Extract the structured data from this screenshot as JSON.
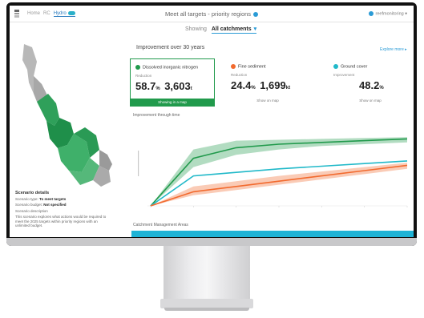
{
  "header": {
    "tabs": [
      {
        "label": "Home"
      },
      {
        "label": "RC"
      },
      {
        "label": "Hydro"
      }
    ],
    "title": "Meet all targets - priority regions",
    "user": "reefmonitoring"
  },
  "showing": {
    "label": "Showing",
    "value": "All catchments"
  },
  "panel": {
    "title": "Improvement over 30 years",
    "explore_link": "Explore more ▸"
  },
  "cards": [
    {
      "label": "Dissolved inorganic nitrogen",
      "color": "#219a4c",
      "sub": "Reduction",
      "percent": "58.7",
      "percent_unit": "%",
      "amount": "3,603",
      "amount_unit": "t",
      "action": "Showing in a map"
    },
    {
      "label": "Fine sediment",
      "color": "#f26a2e",
      "sub": "Reduction",
      "percent": "24.4",
      "percent_unit": "%",
      "amount": "1,699",
      "amount_unit": "kt",
      "action": "Show on map"
    },
    {
      "label": "Ground cover",
      "color": "#21b9c9",
      "sub": "Improvement",
      "percent": "48.2",
      "percent_unit": "%",
      "amount": "",
      "amount_unit": "",
      "action": "Show on map"
    }
  ],
  "chart_title": "Improvement through time",
  "chart_data": {
    "type": "line",
    "x": [
      0,
      5,
      10,
      15,
      20,
      25,
      30
    ],
    "series": [
      {
        "color": "#219a4c",
        "values": [
          0,
          27,
          33,
          35,
          36,
          37,
          38
        ],
        "band": [
          [
            0,
            0
          ],
          [
            22,
            32
          ],
          [
            29,
            37
          ],
          [
            32,
            37.5
          ],
          [
            34,
            38
          ],
          [
            35,
            38.5
          ],
          [
            36,
            39
          ]
        ]
      },
      {
        "color": "#21b9c9",
        "values": [
          0,
          17,
          19,
          21,
          22.5,
          24,
          25.5
        ]
      },
      {
        "color": "#f26a2e",
        "values": [
          0,
          8,
          11,
          14,
          17,
          20,
          23
        ],
        "band": [
          [
            0,
            0
          ],
          [
            6,
            11
          ],
          [
            9,
            14
          ],
          [
            12,
            17
          ],
          [
            15,
            19.5
          ],
          [
            18,
            22
          ],
          [
            21,
            24.5
          ]
        ]
      }
    ],
    "ylim": [
      0,
      45
    ],
    "grid": false
  },
  "left_panel": {
    "title": "Scenario details",
    "rows": [
      {
        "key": "Scenario type:",
        "value": "To meet targets"
      },
      {
        "key": "Scenario budget:",
        "value": "Not specified"
      }
    ],
    "section": "Scenario description",
    "description": "This scenario explores what actions would be required to meet the 2025 targets within priority regions with an unlimited budget."
  },
  "bottom_label": "Catchment Management Areas"
}
